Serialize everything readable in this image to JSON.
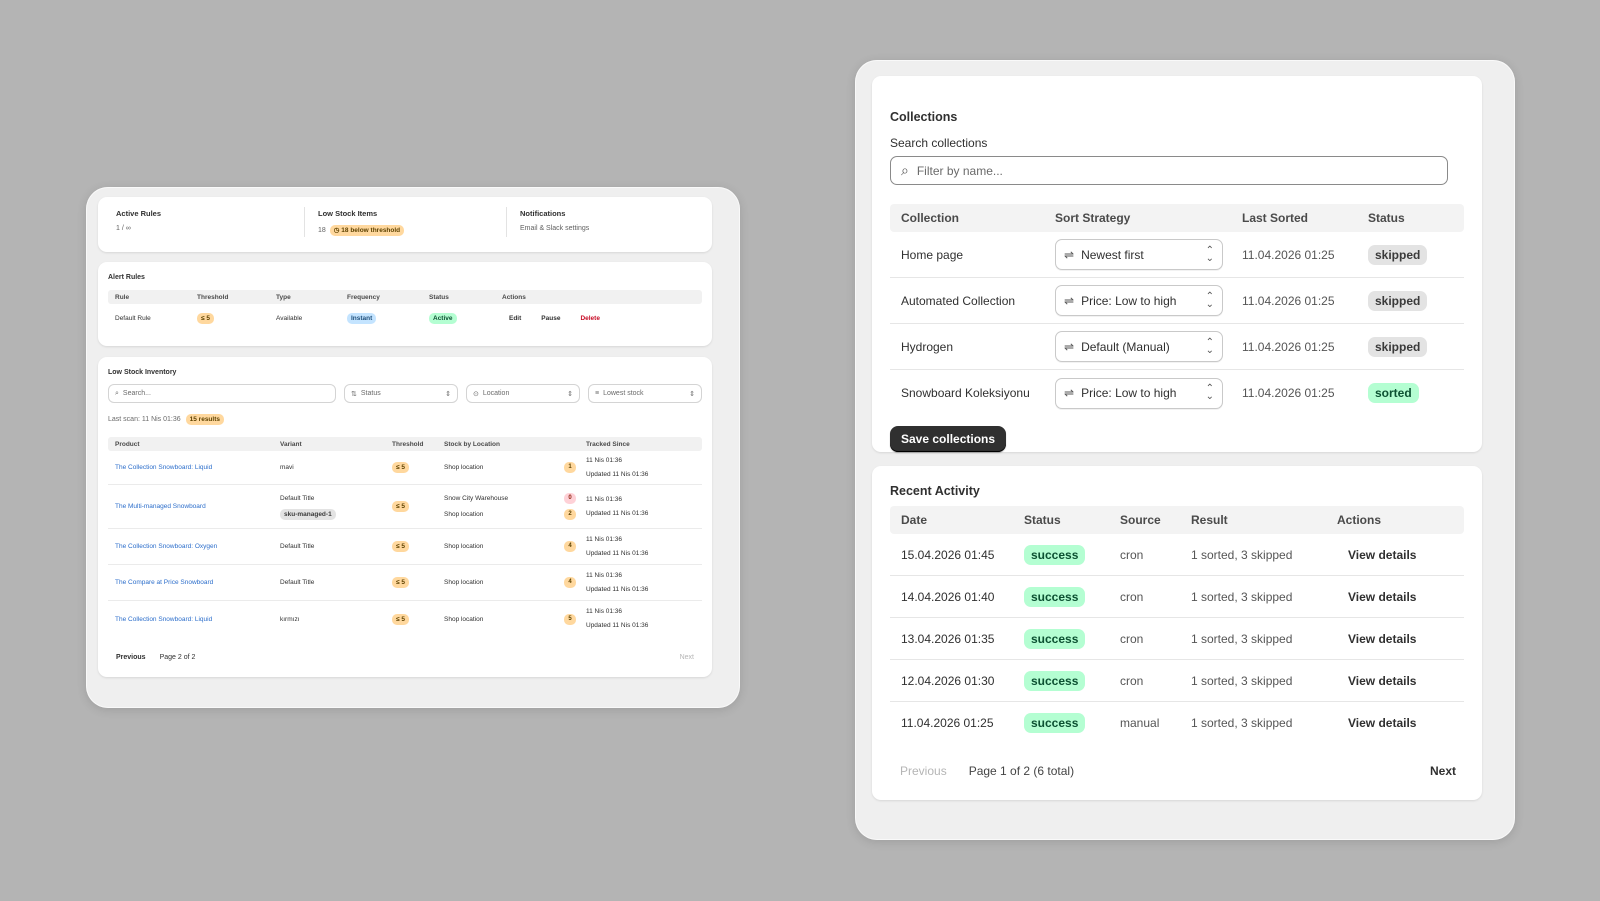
{
  "left": {
    "stats": [
      {
        "label": "Active Rules",
        "value": "1 / ∞"
      },
      {
        "label": "Low Stock Items",
        "value": "18",
        "badge": "18 below threshold"
      },
      {
        "label": "Notifications",
        "value": "Email & Slack settings"
      }
    ],
    "alert_rules": {
      "title": "Alert Rules",
      "headers": [
        "Rule",
        "Threshold",
        "Type",
        "Frequency",
        "Status",
        "Actions"
      ],
      "rows": [
        {
          "rule": "Default Rule",
          "threshold": "≤ 5",
          "type": "Available",
          "frequency": "Instant",
          "status": "Active",
          "actions": [
            "Edit",
            "Pause",
            "Delete"
          ]
        }
      ]
    },
    "inventory": {
      "title": "Low Stock Inventory",
      "search_placeholder": "Search...",
      "filters": [
        "Status",
        "Location",
        "Lowest stock"
      ],
      "last_scan": "Last scan: 11 Nis 01:36",
      "results_badge": "15 results",
      "headers": [
        "Product",
        "Variant",
        "Threshold",
        "Stock by Location",
        "Tracked Since"
      ],
      "rows": [
        {
          "product": "The Collection Snowboard: Liquid",
          "variant": "mavi",
          "variant_tag": "",
          "threshold": "≤ 5",
          "locations": [
            {
              "name": "Shop location",
              "qty": "1"
            }
          ],
          "tracked": "11 Nis 01:36",
          "updated": "Updated 11 Nis 01:36"
        },
        {
          "product": "The Multi-managed Snowboard",
          "variant": "Default Title",
          "variant_tag": "sku-managed-1",
          "threshold": "≤ 5",
          "locations": [
            {
              "name": "Snow City Warehouse",
              "qty": "0"
            },
            {
              "name": "Shop location",
              "qty": "2"
            }
          ],
          "tracked": "11 Nis 01:36",
          "updated": "Updated 11 Nis 01:36"
        },
        {
          "product": "The Collection Snowboard: Oxygen",
          "variant": "Default Title",
          "variant_tag": "",
          "threshold": "≤ 5",
          "locations": [
            {
              "name": "Shop location",
              "qty": "4"
            }
          ],
          "tracked": "11 Nis 01:36",
          "updated": "Updated 11 Nis 01:36"
        },
        {
          "product": "The Compare at Price Snowboard",
          "variant": "Default Title",
          "variant_tag": "",
          "threshold": "≤ 5",
          "locations": [
            {
              "name": "Shop location",
              "qty": "4"
            }
          ],
          "tracked": "11 Nis 01:36",
          "updated": "Updated 11 Nis 01:36"
        },
        {
          "product": "The Collection Snowboard: Liquid",
          "variant": "kırmızı",
          "variant_tag": "",
          "threshold": "≤ 5",
          "locations": [
            {
              "name": "Shop location",
              "qty": "5"
            }
          ],
          "tracked": "11 Nis 01:36",
          "updated": "Updated 11 Nis 01:36"
        }
      ],
      "pager": {
        "previous": "Previous",
        "page": "Page 2 of 2",
        "next": "Next"
      }
    }
  },
  "right": {
    "collections": {
      "title": "Collections",
      "search_label": "Search collections",
      "search_placeholder": "Filter by name...",
      "headers": [
        "Collection",
        "Sort Strategy",
        "Last Sorted",
        "Status"
      ],
      "rows": [
        {
          "name": "Home page",
          "strategy": "Newest first",
          "last_sorted": "11.04.2026 01:25",
          "status": "skipped"
        },
        {
          "name": "Automated Collection",
          "strategy": "Price: Low to high",
          "last_sorted": "11.04.2026 01:25",
          "status": "skipped"
        },
        {
          "name": "Hydrogen",
          "strategy": "Default (Manual)",
          "last_sorted": "11.04.2026 01:25",
          "status": "skipped"
        },
        {
          "name": "Snowboard Koleksiyonu",
          "strategy": "Price: Low to high",
          "last_sorted": "11.04.2026 01:25",
          "status": "sorted"
        }
      ],
      "save_label": "Save collections"
    },
    "activity": {
      "title": "Recent Activity",
      "headers": [
        "Date",
        "Status",
        "Source",
        "Result",
        "Actions"
      ],
      "rows": [
        {
          "date": "15.04.2026 01:45",
          "status": "success",
          "source": "cron",
          "result": "1 sorted, 3 skipped",
          "action": "View details"
        },
        {
          "date": "14.04.2026 01:40",
          "status": "success",
          "source": "cron",
          "result": "1 sorted, 3 skipped",
          "action": "View details"
        },
        {
          "date": "13.04.2026 01:35",
          "status": "success",
          "source": "cron",
          "result": "1 sorted, 3 skipped",
          "action": "View details"
        },
        {
          "date": "12.04.2026 01:30",
          "status": "success",
          "source": "cron",
          "result": "1 sorted, 3 skipped",
          "action": "View details"
        },
        {
          "date": "11.04.2026 01:25",
          "status": "success",
          "source": "manual",
          "result": "1 sorted, 3 skipped",
          "action": "View details"
        }
      ],
      "pager": {
        "previous": "Previous",
        "page": "Page 1 of 2 (6 total)",
        "next": "Next"
      }
    }
  }
}
